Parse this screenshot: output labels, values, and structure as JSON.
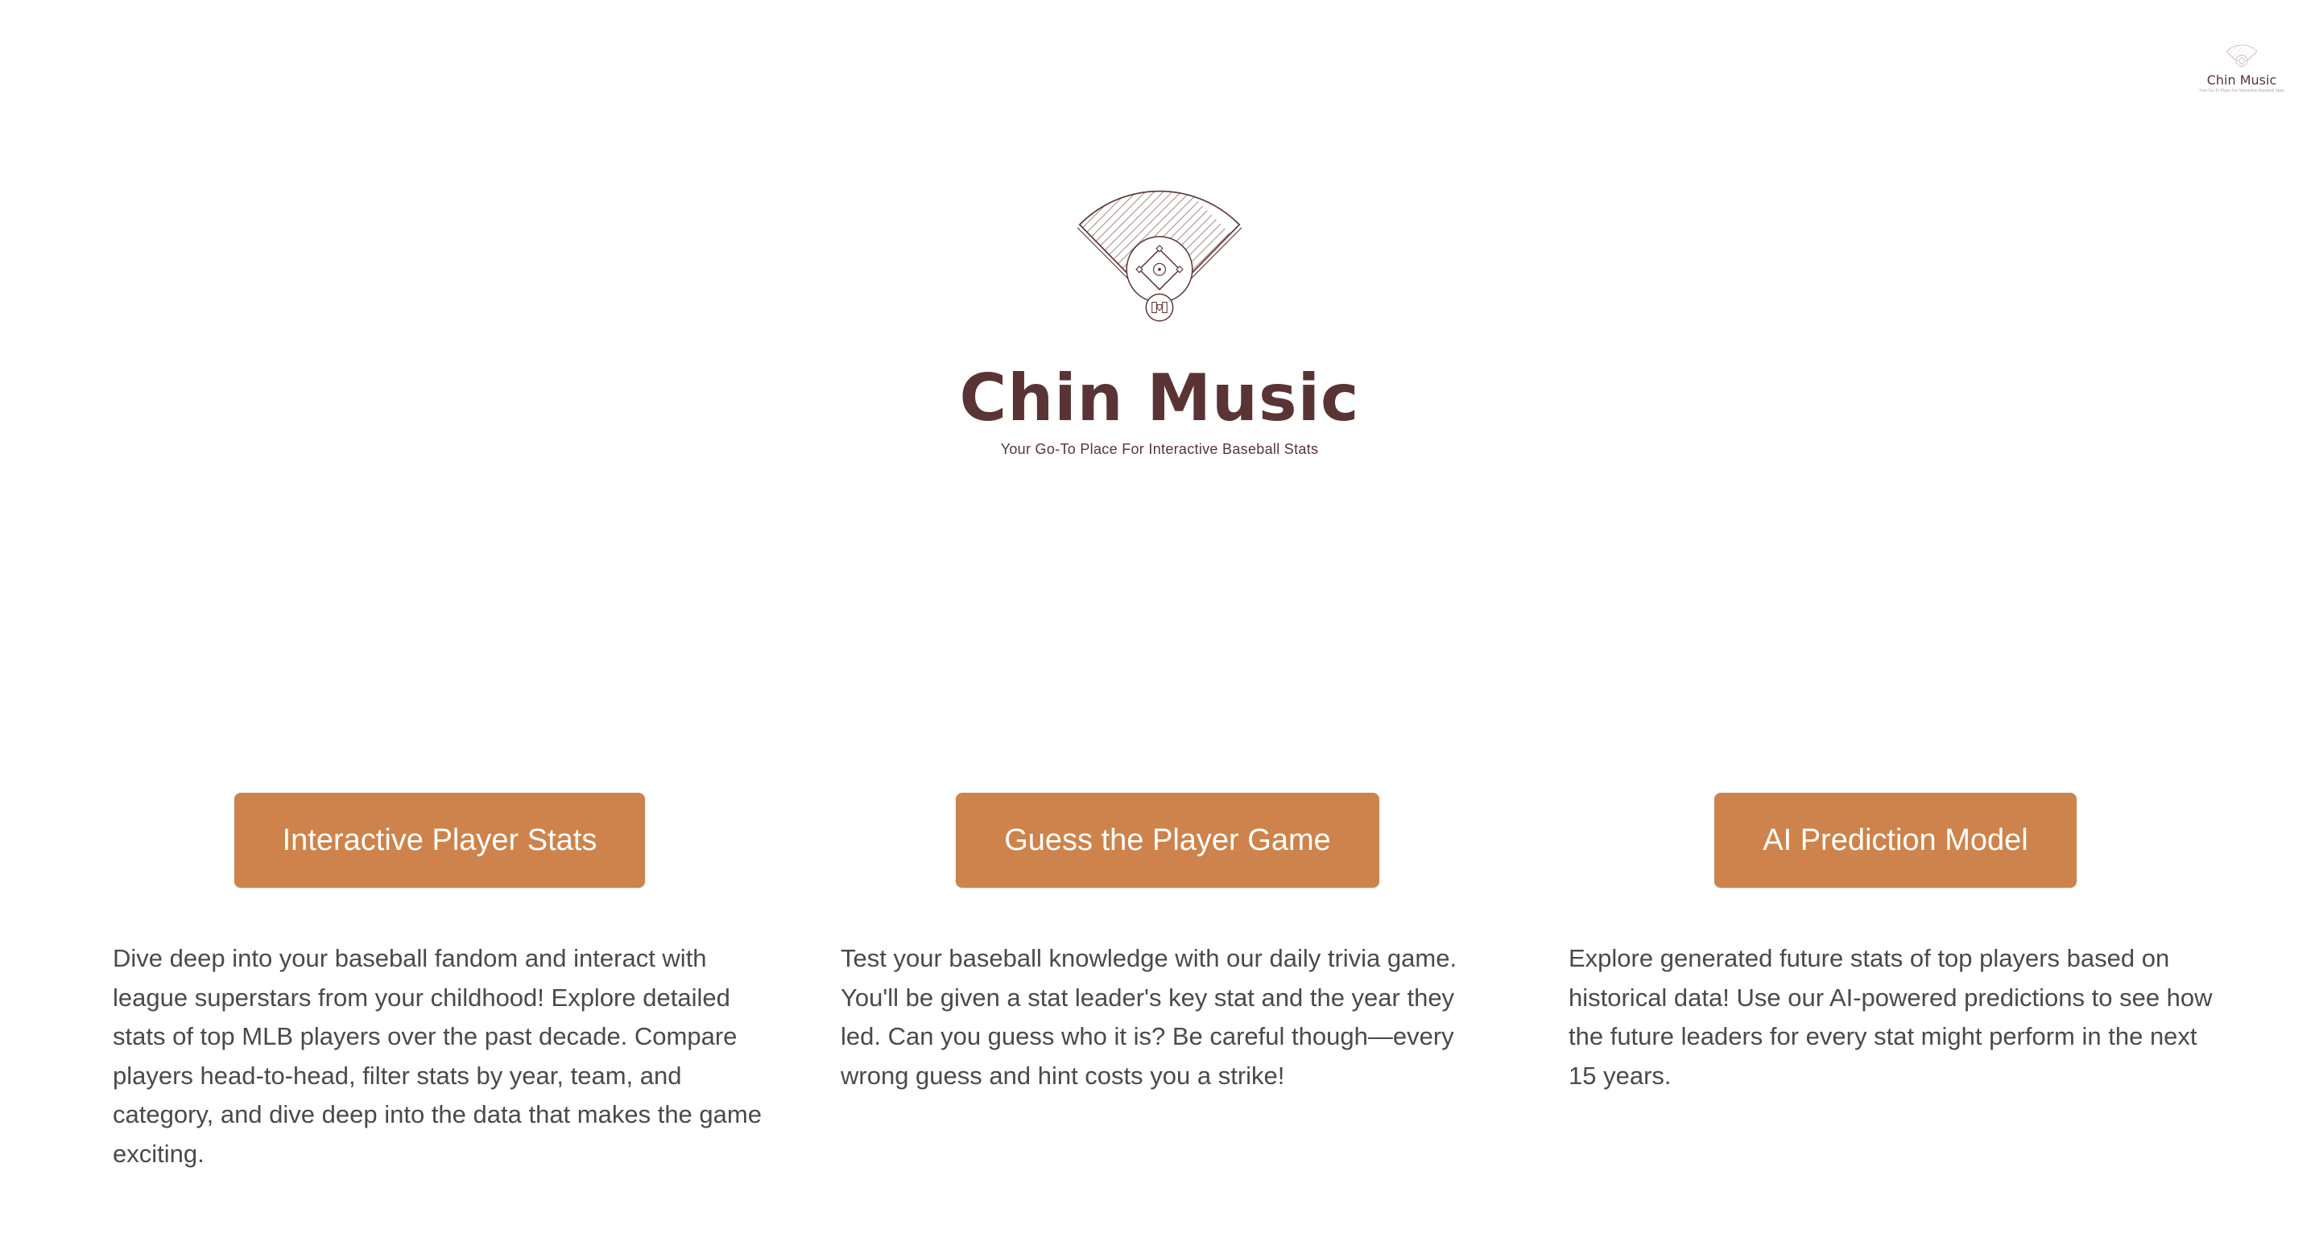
{
  "brand": {
    "title": "Chin Music",
    "subtitle": "Your Go-To Place For Interactive Baseball Stats",
    "corner_title": "Chin Music",
    "corner_subtitle": "Your Go-To Place For Interactive Baseball Stats"
  },
  "colors": {
    "brand_brown": "#5a3434",
    "button_orange": "#cd834b",
    "body_text": "#4a4a4a"
  },
  "icons": {
    "hero_logo": "baseball-field-icon",
    "corner_logo": "baseball-field-icon"
  },
  "features": [
    {
      "button_label": "Interactive Player Stats",
      "description": "Dive deep into your baseball fandom and interact with league superstars from your childhood! Explore detailed stats of top MLB players over the past decade. Compare players head-to-head, filter stats by year, team, and category, and dive deep into the data that makes the game exciting."
    },
    {
      "button_label": "Guess the Player Game",
      "description": "Test your baseball knowledge with our daily trivia game. You'll be given a stat leader's key stat and the year they led. Can you guess who it is? Be careful though—every wrong guess and hint costs you a strike!"
    },
    {
      "button_label": "AI Prediction Model",
      "description": "Explore generated future stats of top players based on historical data! Use our AI-powered predictions to see how the future leaders for every stat might perform in the next 15 years."
    }
  ]
}
